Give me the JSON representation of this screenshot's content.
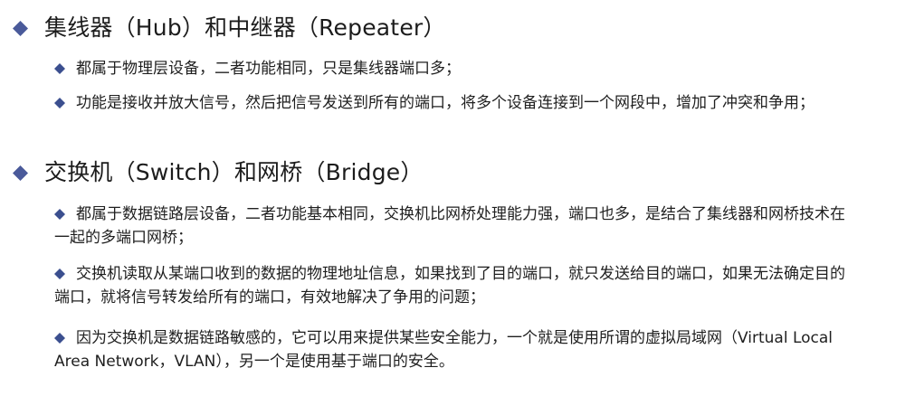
{
  "colors": {
    "main_bullet": "#4a5a9a",
    "sub_bullet": "#3b4f8f",
    "text": "#1c1c1c"
  },
  "sections": [
    {
      "title": "集线器（Hub）和中继器（Repeater）",
      "items": [
        "都属于物理层设备，二者功能相同，只是集线器端口多；",
        "功能是接收并放大信号，然后把信号发送到所有的端口，将多个设备连接到一个网段中，增加了冲突和争用；"
      ]
    },
    {
      "title": "交换机（Switch）和网桥（Bridge）",
      "items": [
        "都属于数据链路层设备，二者功能基本相同，交换机比网桥处理能力强，端口也多，是结合了集线器和网桥技术在一起的多端口网桥；",
        "交换机读取从某端口收到的数据的物理地址信息，如果找到了目的端口，就只发送给目的端口，如果无法确定目的端口，就将信号转发给所有的端口，有效地解决了争用的问题；",
        "因为交换机是数据链路敏感的，它可以用来提供某些安全能力，一个就是使用所谓的虚拟局域网（Virtual Local Area Network，VLAN），另一个是使用基于端口的安全。"
      ]
    }
  ]
}
